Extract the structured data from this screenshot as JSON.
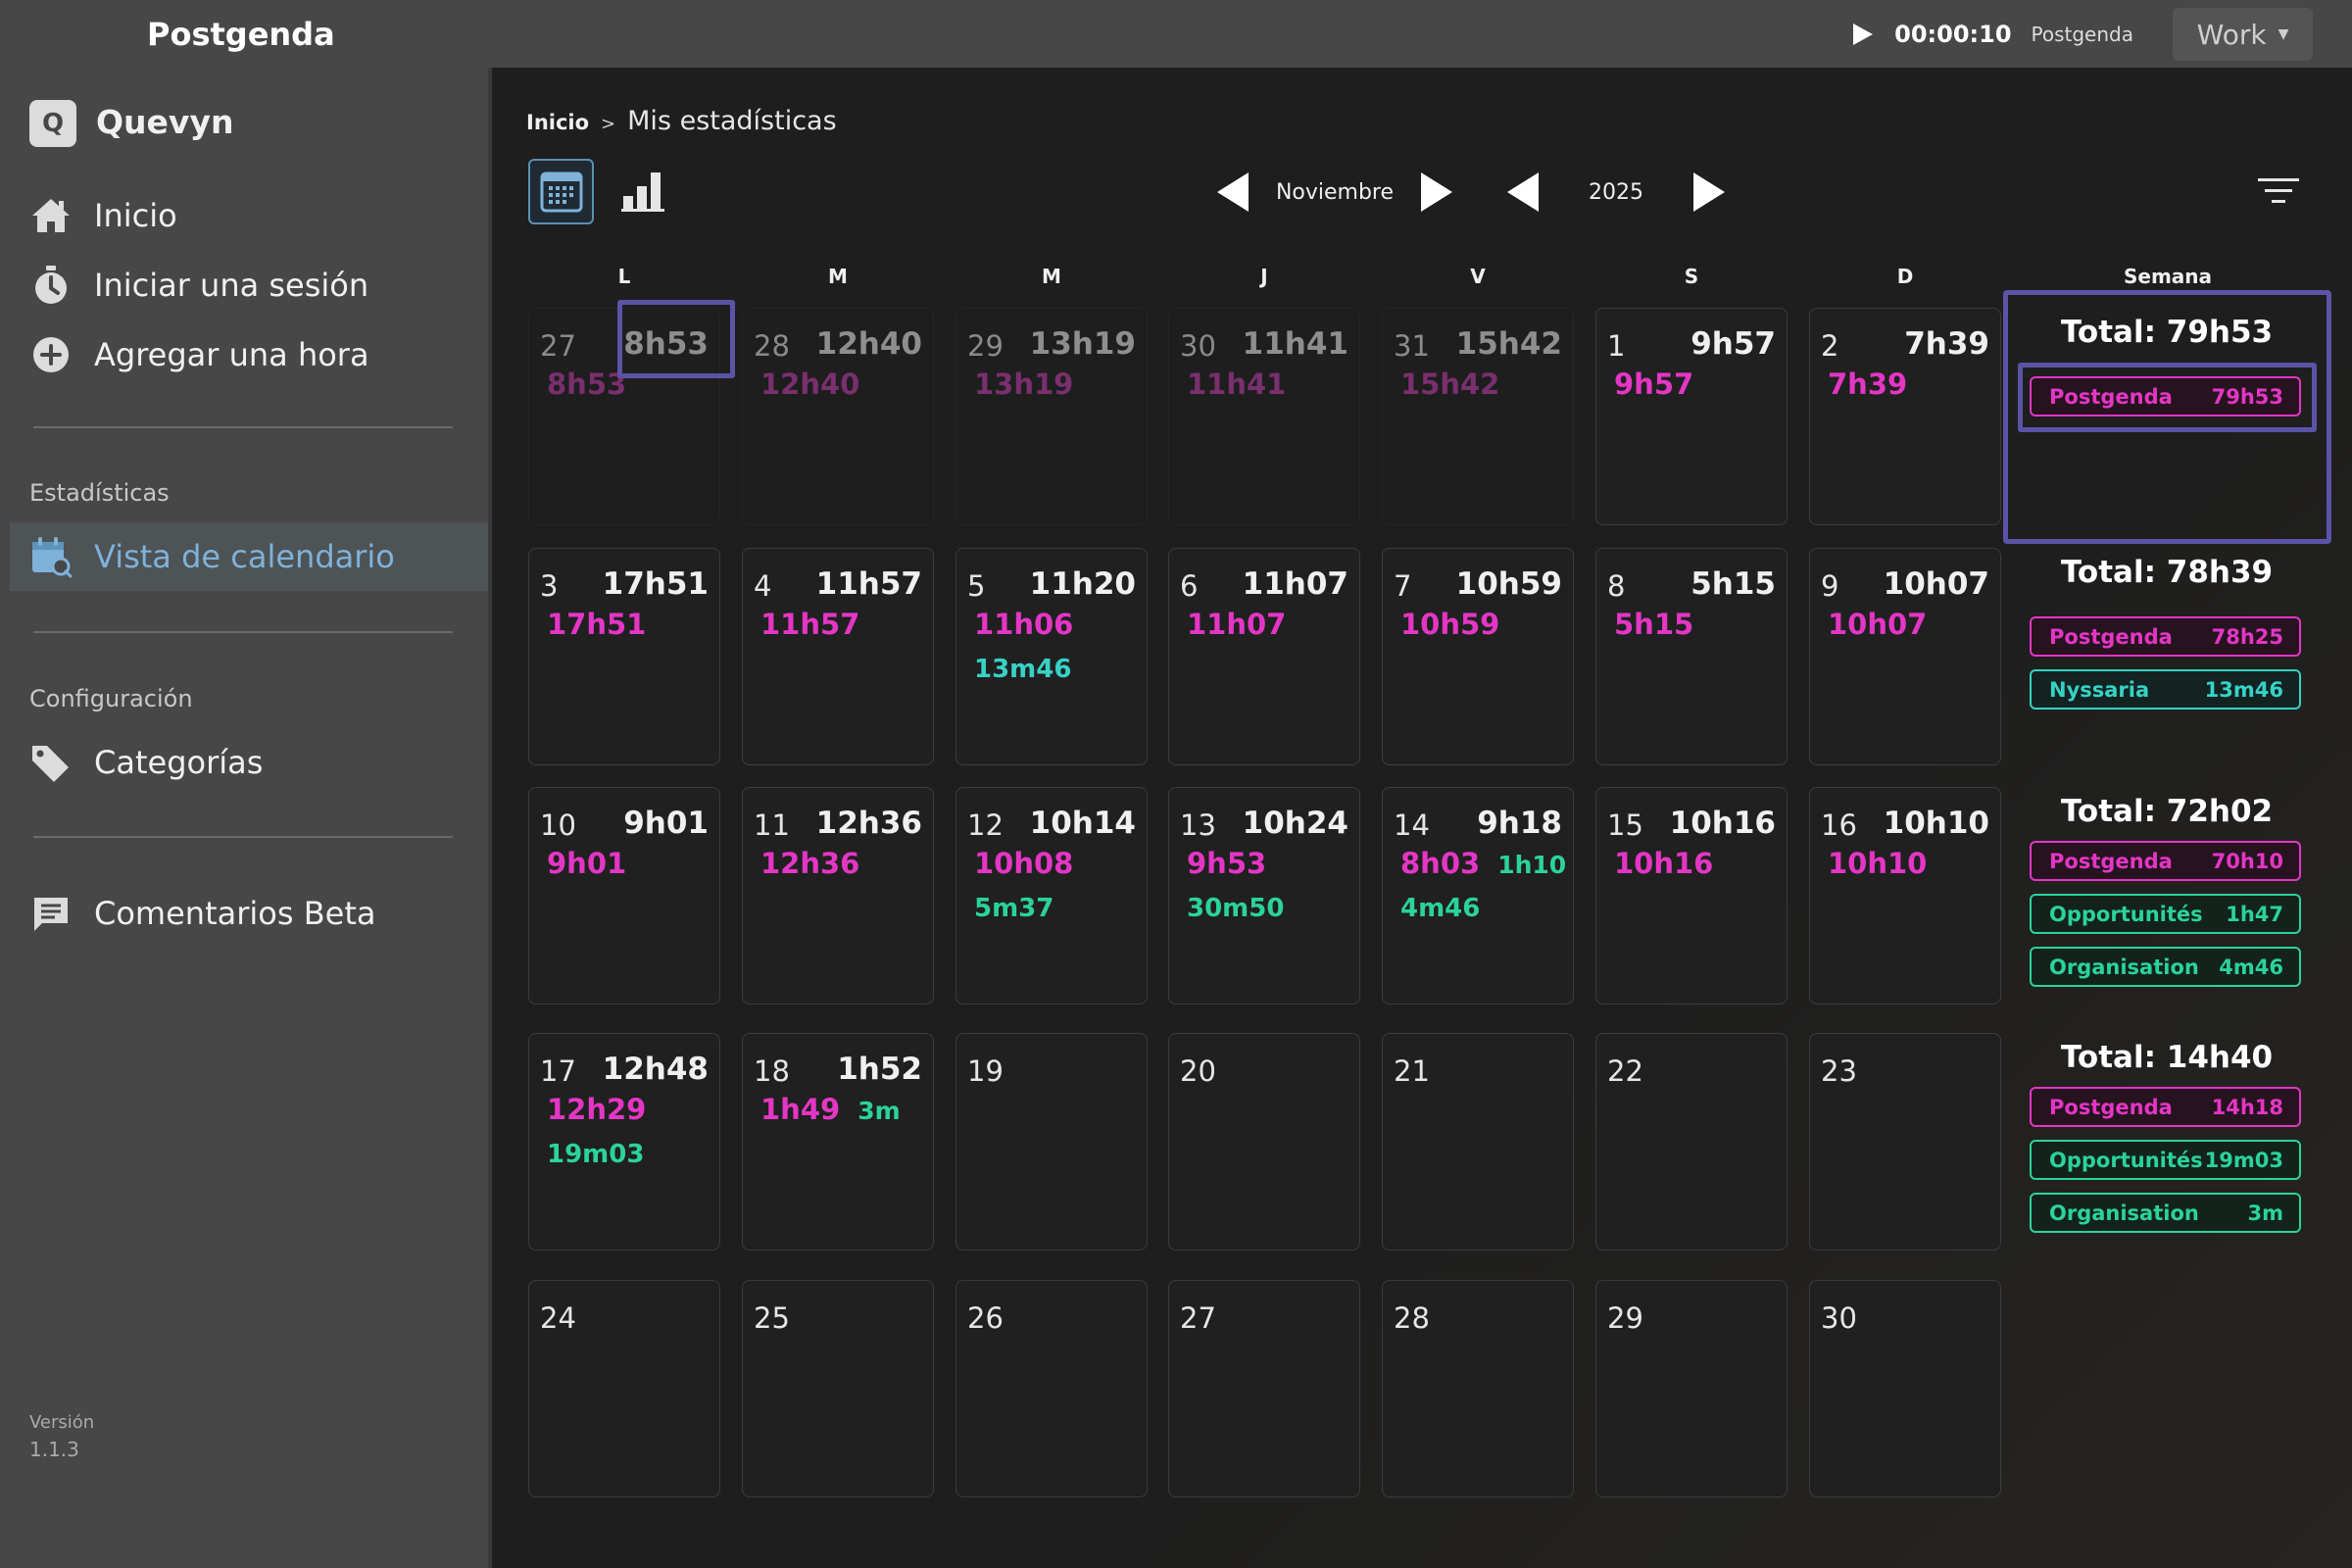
{
  "app": {
    "title": "Postgenda"
  },
  "timer": {
    "time": "00:00:10",
    "project": "Postgenda",
    "workspace": "Work"
  },
  "sidebar": {
    "brand": {
      "letter": "Q",
      "name": "Quevyn"
    },
    "nav": [
      {
        "label": "Inicio",
        "icon": "home-icon"
      },
      {
        "label": "Iniciar una sesión",
        "icon": "stopwatch-icon"
      },
      {
        "label": "Agregar una hora",
        "icon": "add-circle-icon"
      }
    ],
    "stats_label": "Estadísticas",
    "calendar_view": "Vista de calendario",
    "config_label": "Configuración",
    "categories": "Categorías",
    "feedback": "Comentarios Beta",
    "version_label": "Versión",
    "version": "1.1.3"
  },
  "breadcrumb": {
    "home": "Inicio",
    "sep": ">",
    "current": "Mis estadísticas"
  },
  "nav": {
    "month": "Noviembre",
    "year": "2025"
  },
  "weekdays": [
    "L",
    "M",
    "M",
    "J",
    "V",
    "S",
    "D"
  ],
  "week_header": "Semana",
  "weeks": [
    {
      "days": [
        {
          "num": "27",
          "total": "8h53",
          "e1": "8h53",
          "past": true,
          "highlight": true
        },
        {
          "num": "28",
          "total": "12h40",
          "e1": "12h40",
          "past": true
        },
        {
          "num": "29",
          "total": "13h19",
          "e1": "13h19",
          "past": true
        },
        {
          "num": "30",
          "total": "11h41",
          "e1": "11h41",
          "past": true
        },
        {
          "num": "31",
          "total": "15h42",
          "e1": "15h42",
          "past": true
        },
        {
          "num": "1",
          "total": "9h57",
          "e1": "9h57"
        },
        {
          "num": "2",
          "total": "7h39",
          "e1": "7h39"
        }
      ],
      "summary": {
        "total": "Total: 79h53",
        "pills": [
          {
            "name": "Postgenda",
            "value": "79h53",
            "color": "pink"
          }
        ]
      }
    },
    {
      "days": [
        {
          "num": "3",
          "total": "17h51",
          "e1": "17h51"
        },
        {
          "num": "4",
          "total": "11h57",
          "e1": "11h57"
        },
        {
          "num": "5",
          "total": "11h20",
          "e1": "11h06",
          "e2": "13m46",
          "e2color": "teal"
        },
        {
          "num": "6",
          "total": "11h07",
          "e1": "11h07"
        },
        {
          "num": "7",
          "total": "10h59",
          "e1": "10h59"
        },
        {
          "num": "8",
          "total": "5h15",
          "e1": "5h15"
        },
        {
          "num": "9",
          "total": "10h07",
          "e1": "10h07"
        }
      ],
      "summary": {
        "total": "Total: 78h39",
        "pills": [
          {
            "name": "Postgenda",
            "value": "78h25",
            "color": "pink"
          },
          {
            "name": "Nyssaria",
            "value": "13m46",
            "color": "teal"
          }
        ]
      }
    },
    {
      "days": [
        {
          "num": "10",
          "total": "9h01",
          "e1": "9h01"
        },
        {
          "num": "11",
          "total": "12h36",
          "e1": "12h36"
        },
        {
          "num": "12",
          "total": "10h14",
          "e1": "10h08",
          "e2": "5m37"
        },
        {
          "num": "13",
          "total": "10h24",
          "e1": "9h53",
          "e2": "30m50"
        },
        {
          "num": "14",
          "total": "9h18",
          "e1": "8h03",
          "side": "1h10",
          "e2": "4m46"
        },
        {
          "num": "15",
          "total": "10h16",
          "e1": "10h16"
        },
        {
          "num": "16",
          "total": "10h10",
          "e1": "10h10"
        }
      ],
      "summary": {
        "total": "Total: 72h02",
        "pills": [
          {
            "name": "Postgenda",
            "value": "70h10",
            "color": "pink"
          },
          {
            "name": "Opportunités",
            "value": "1h47",
            "color": "green"
          },
          {
            "name": "Organisation",
            "value": "4m46",
            "color": "green"
          }
        ]
      }
    },
    {
      "days": [
        {
          "num": "17",
          "total": "12h48",
          "e1": "12h29",
          "e2": "19m03"
        },
        {
          "num": "18",
          "total": "1h52",
          "e1": "1h49",
          "side": "3m"
        },
        {
          "num": "19"
        },
        {
          "num": "20"
        },
        {
          "num": "21"
        },
        {
          "num": "22"
        },
        {
          "num": "23"
        }
      ],
      "summary": {
        "total": "Total: 14h40",
        "pills": [
          {
            "name": "Postgenda",
            "value": "14h18",
            "color": "pink"
          },
          {
            "name": "Opportunités",
            "value": "19m03",
            "color": "green"
          },
          {
            "name": "Organisation",
            "value": "3m",
            "color": "green"
          }
        ]
      }
    },
    {
      "days": [
        {
          "num": "24"
        },
        {
          "num": "25"
        },
        {
          "num": "26"
        },
        {
          "num": "27"
        },
        {
          "num": "28"
        },
        {
          "num": "29"
        },
        {
          "num": "30"
        }
      ]
    }
  ],
  "colors": {
    "accent": "#7fb2d9",
    "pink": "#e436c5",
    "green": "#2bd39a",
    "teal": "#37d2c6",
    "highlight": "#5b53a6"
  }
}
